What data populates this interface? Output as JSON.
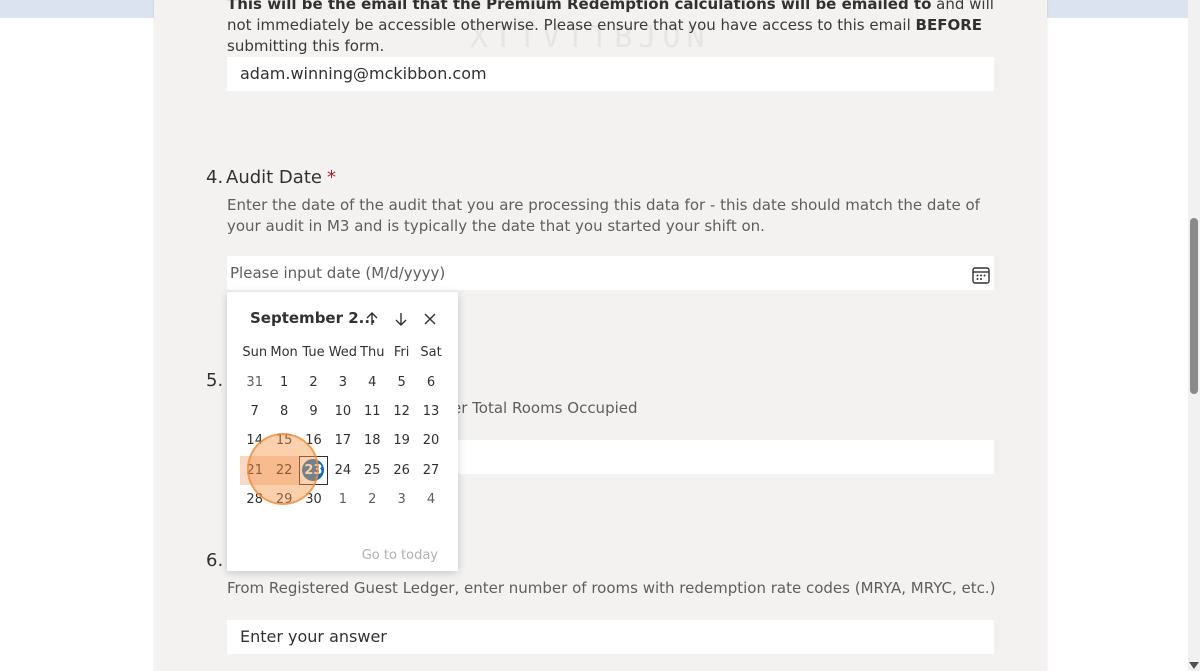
{
  "email_section": {
    "desc_bold": "This will be the email that the Premium Redemption calculations will be emailed to",
    "desc_mid": " and will not immediately be accessible otherwise. Please ensure that you have access to this email ",
    "desc_bold2": "BEFORE",
    "desc_end": " submitting this form.",
    "value": "adam.winning@mckibbon.com",
    "ghost": "XTTVTTBJON"
  },
  "question4": {
    "number": "4.",
    "title": "Audit Date",
    "required_mark": "*",
    "description": "Enter the date of the audit that you are processing this data for - this date should match the date of your audit in M3 and is typically the date that you started your shift on.",
    "placeholder": "Please input date (M/d/yyyy)",
    "icon": "calendar-icon"
  },
  "question5": {
    "number": "5.",
    "description_visible": "er Total Rooms Occupied"
  },
  "question6": {
    "number": "6.",
    "description": "From Registered Guest Ledger, enter number of rooms with redemption rate codes (MRYA, MRYC, etc.)",
    "placeholder": "Enter your answer"
  },
  "date_picker": {
    "month_label": "September 2...",
    "prev_icon": "arrow-up-icon",
    "next_icon": "arrow-down-icon",
    "close_icon": "close-icon",
    "weekdays": [
      "Sun",
      "Mon",
      "Tue",
      "Wed",
      "Thu",
      "Fri",
      "Sat"
    ],
    "weeks": [
      [
        "31",
        "1",
        "2",
        "3",
        "4",
        "5",
        "6"
      ],
      [
        "7",
        "8",
        "9",
        "10",
        "11",
        "12",
        "13"
      ],
      [
        "14",
        "15",
        "16",
        "17",
        "18",
        "19",
        "20"
      ],
      [
        "21",
        "22",
        "23",
        "24",
        "25",
        "26",
        "27"
      ],
      [
        "28",
        "29",
        "30",
        "1",
        "2",
        "3",
        "4"
      ]
    ],
    "selected_day": "23",
    "go_to_today": "Go to today"
  },
  "colors": {
    "accent": "#0f6cbd",
    "required": "#a4262c",
    "highlight": "#f8d9c6",
    "click_marker": "#f79646"
  }
}
